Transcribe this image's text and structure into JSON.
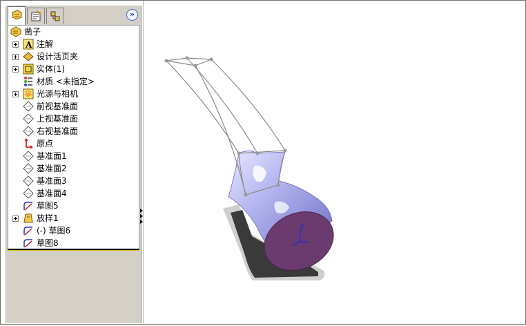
{
  "panel": {
    "tabs": [
      "feature-manager-tab",
      "property-manager-tab",
      "configuration-manager-tab"
    ],
    "expand_label": "»"
  },
  "tree": {
    "root": "凿子",
    "items": [
      {
        "label": "注解",
        "icon": "annotations-icon",
        "expandable": true
      },
      {
        "label": "设计活页夹",
        "icon": "design-binder-icon",
        "expandable": true
      },
      {
        "label": "实体(1)",
        "icon": "solid-bodies-icon",
        "expandable": true
      },
      {
        "label": "材质 <未指定>",
        "icon": "material-icon",
        "expandable": false
      },
      {
        "label": "光源与相机",
        "icon": "lights-cameras-icon",
        "expandable": true
      },
      {
        "label": "前视基准面",
        "icon": "plane-icon",
        "expandable": false
      },
      {
        "label": "上视基准面",
        "icon": "plane-icon",
        "expandable": false
      },
      {
        "label": "右视基准面",
        "icon": "plane-icon",
        "expandable": false
      },
      {
        "label": "原点",
        "icon": "origin-icon",
        "expandable": false
      },
      {
        "label": "基准面1",
        "icon": "plane-icon",
        "expandable": false
      },
      {
        "label": "基准面2",
        "icon": "plane-icon",
        "expandable": false
      },
      {
        "label": "基准面3",
        "icon": "plane-icon",
        "expandable": false
      },
      {
        "label": "基准面4",
        "icon": "plane-icon",
        "expandable": false
      },
      {
        "label": "草图5",
        "icon": "sketch-icon",
        "expandable": false
      },
      {
        "label": "放样1",
        "icon": "loft-icon",
        "expandable": true
      },
      {
        "label": "(-) 草图6",
        "icon": "sketch-icon",
        "expandable": false
      },
      {
        "label": "草图8",
        "icon": "sketch-icon",
        "expandable": false
      }
    ]
  },
  "colors": {
    "panel_bg": "#d4d0c8",
    "tree_bg": "#ffffff",
    "model_body": "#b8b8f0",
    "model_face": "#6b3a6e",
    "shadow": "#3a3a3a",
    "sketch_line": "#8a8a8a",
    "axis_blue": "#1a2fd6"
  }
}
